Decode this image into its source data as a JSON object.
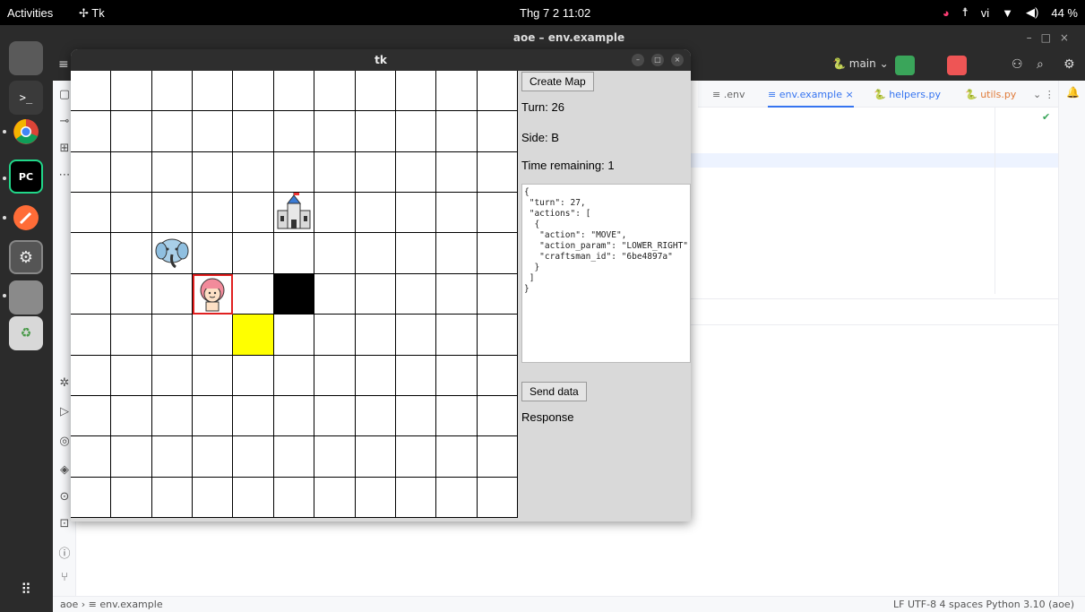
{
  "topbar": {
    "activities": "Activities",
    "app": "✢ Tk",
    "clock": "Thg 7 2  11:02",
    "lang": "vi",
    "battery": "44 %"
  },
  "ide": {
    "window_title": "aoe – env.example",
    "branch": "main",
    "tabs": [
      ".env",
      "env.example",
      "helpers.py",
      "utils.py"
    ],
    "status_crumb": "aoe  ›  ≡ env.example",
    "status_info": "LF   UTF-8   4 spaces   Python 3.10 (aoe)"
  },
  "tk": {
    "title": "tk",
    "create_map": "Create Map",
    "turn": "Turn: 26",
    "side": "Side: B",
    "time": "Time remaining: 1",
    "json_text": "{\n \"turn\": 27,\n \"actions\": [\n  {\n   \"action\": \"MOVE\",\n   \"action_param\": \"LOWER_RIGHT\",\n   \"craftsman_id\": \"6be4897a\"\n  }\n ]\n}",
    "send_data": "Send data",
    "response": "Response"
  },
  "board": {
    "rows": 11,
    "cols": 11,
    "castle": {
      "row": 3,
      "col": 5
    },
    "elephant": {
      "row": 4,
      "col": 2
    },
    "craftsman": {
      "row": 5,
      "col": 3
    },
    "black": {
      "row": 5,
      "col": 5
    },
    "yellow": {
      "row": 6,
      "col": 4
    },
    "colors": {
      "selected": "#e02020",
      "black": "#000000",
      "yellow": "#ffff00"
    }
  },
  "icons": [
    "chrome-icon",
    "pycharm-icon",
    "postman-icon",
    "settings-icon",
    "terminal-icon",
    "trash-icon",
    "apps-grid-icon"
  ]
}
